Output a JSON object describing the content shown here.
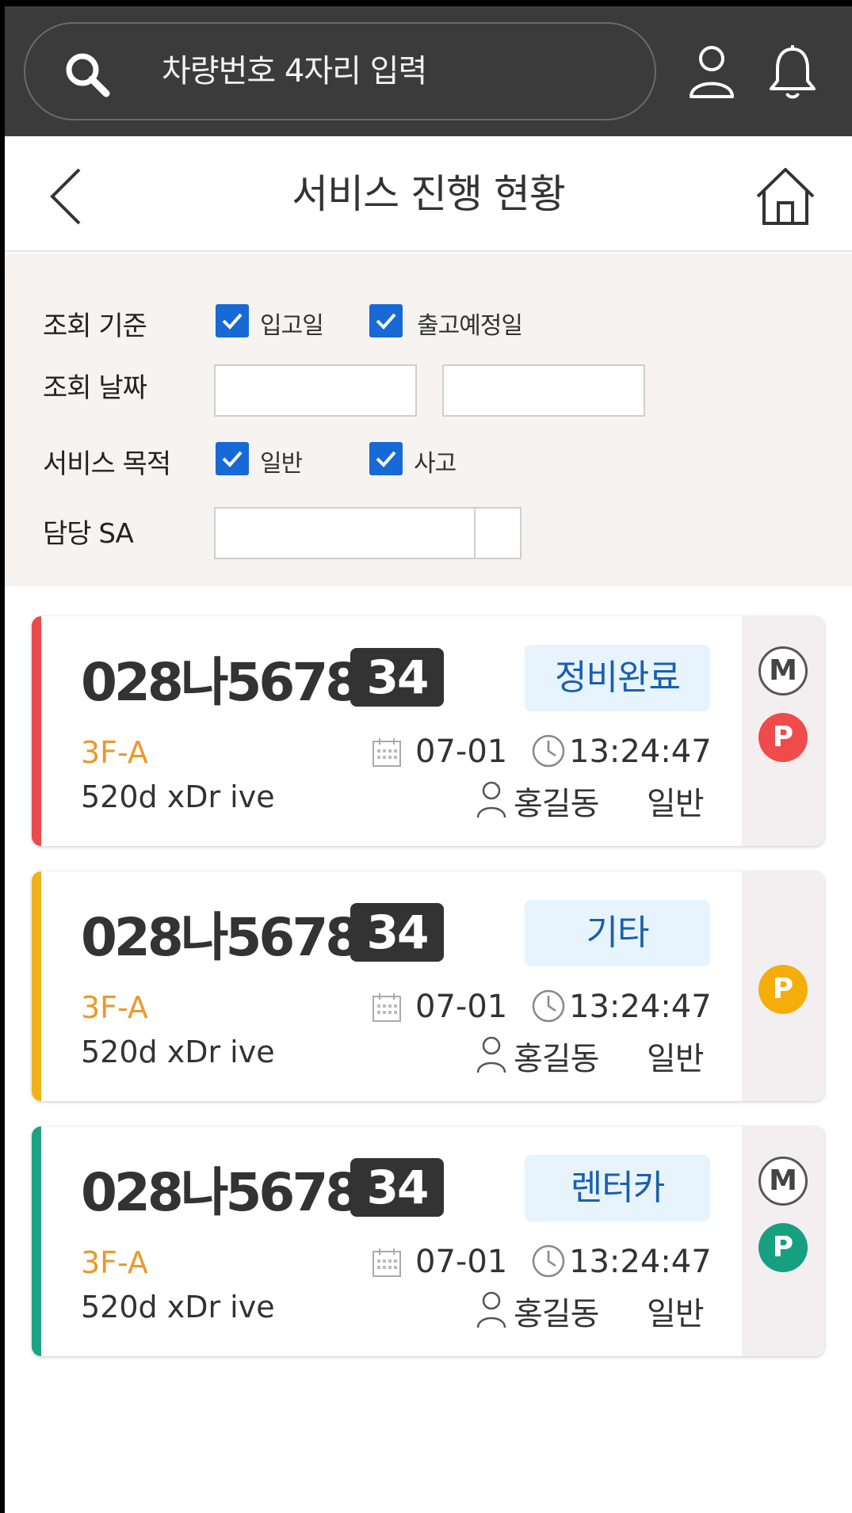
{
  "search": {
    "placeholder": "차량번호 4자리 입력"
  },
  "icons": {
    "search": "search-icon",
    "user": "user-icon",
    "bell": "bell-icon",
    "back": "back-icon",
    "home": "home-icon",
    "calendar": "calendar-icon",
    "clock": "clock-icon",
    "person": "person-icon"
  },
  "header": {
    "title": "서비스 진행 현황"
  },
  "filter": {
    "criteria_label": "조회 기준",
    "criteria_options": [
      {
        "label": "입고일",
        "checked": true
      },
      {
        "label": "출고예정일",
        "checked": true
      }
    ],
    "date_label": "조회 날짜",
    "date_from": "",
    "date_to": "",
    "purpose_label": "서비스 목적",
    "purpose_options": [
      {
        "label": "일반",
        "checked": true
      },
      {
        "label": "사고",
        "checked": true
      }
    ],
    "sa_label": "담당 SA",
    "sa_value": ""
  },
  "cards": [
    {
      "plate": "028나5678",
      "number": "34",
      "status": "정비완료",
      "location": "3F-A",
      "model": "520d xDr  ive",
      "date": "07-01",
      "time": "13:24:47",
      "sa": "홍길동",
      "purpose": "일반",
      "badges": [
        "M",
        "P"
      ],
      "color": "#e94a4a",
      "p_color": "#ef4b4b"
    },
    {
      "plate": "028나5678",
      "number": "34",
      "status": "기타",
      "location": "3F-A",
      "model": "520d xDr  ive",
      "date": "07-01",
      "time": "13:24:47",
      "sa": "홍길동",
      "purpose": "일반",
      "badges": [
        "P"
      ],
      "color": "#f0b21a",
      "p_color": "#f5ad0c"
    },
    {
      "plate": "028나5678",
      "number": "34",
      "status": "렌터카",
      "location": "3F-A",
      "model": "520d xDr  ive",
      "date": "07-01",
      "time": "13:24:47",
      "sa": "홍길동",
      "purpose": "일반",
      "badges": [
        "M",
        "P"
      ],
      "color": "#1aa283",
      "p_color": "#17a07f"
    }
  ],
  "colors": {
    "topbar": "#3b3b3b",
    "checkbox": "#1769d6",
    "status_text": "#1a5fb0",
    "location_text": "#e99a2a"
  }
}
